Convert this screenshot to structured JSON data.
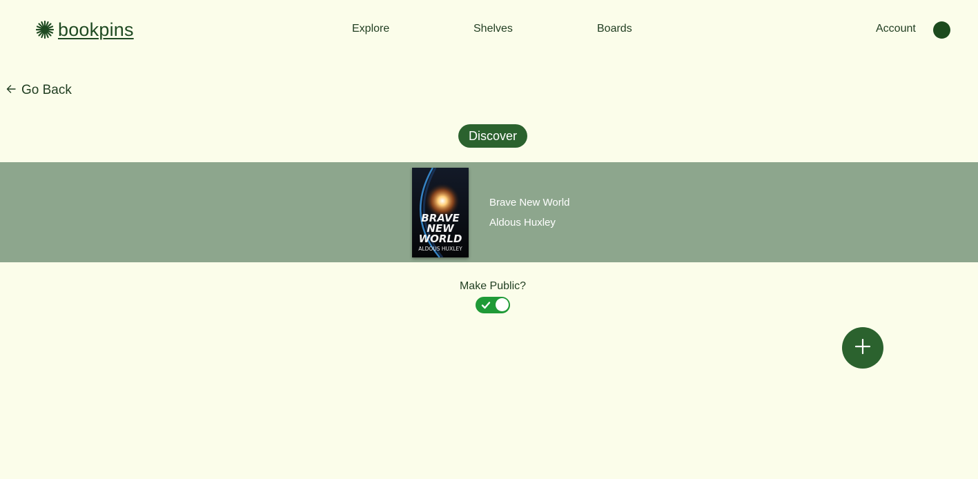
{
  "header": {
    "logo_text": "bookpins",
    "logo_icon": "starburst-icon",
    "nav": [
      {
        "label": "Explore"
      },
      {
        "label": "Shelves"
      },
      {
        "label": "Boards"
      }
    ],
    "account_label": "Account",
    "avatar_color": "#1c4a1e"
  },
  "back": {
    "label": "Go Back",
    "icon": "arrow-left-icon"
  },
  "discover": {
    "label": "Discover"
  },
  "book": {
    "title": "Brave New World",
    "author": "Aldous Huxley",
    "cover_title_lines": [
      "BRAVE",
      "NEW",
      "WORLD"
    ],
    "cover_author": "ALDOUS HUXLEY"
  },
  "public_toggle": {
    "label": "Make Public?",
    "checked": true
  },
  "fab": {
    "icon": "plus-icon"
  },
  "colors": {
    "background": "#fbfdea",
    "primary": "#2b622e",
    "strip": "#8da68d",
    "toggle_on": "#1f9a37"
  }
}
